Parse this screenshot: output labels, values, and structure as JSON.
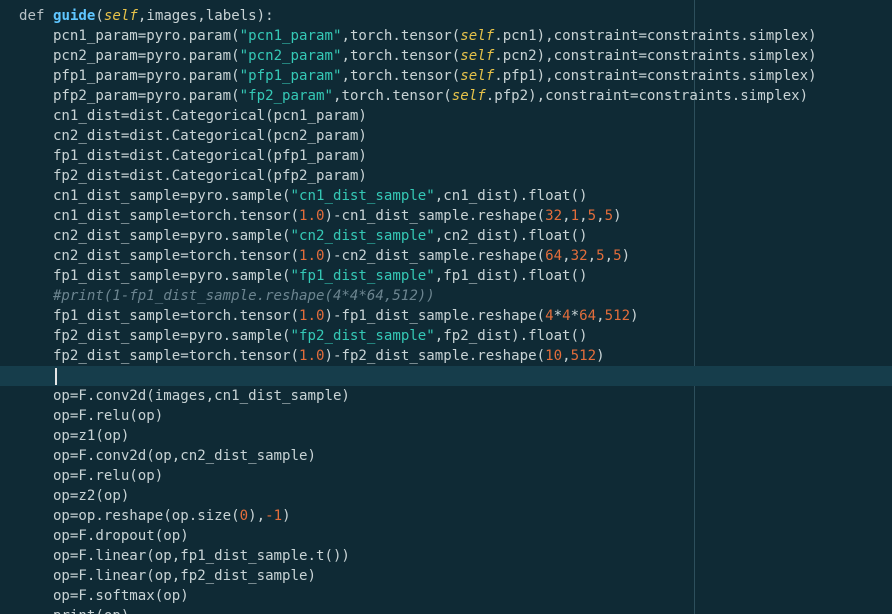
{
  "editor": {
    "colors": {
      "background": "#0f2a35",
      "current_line": "#163d4b",
      "ruler": "#2d4f5c",
      "text": "#c8d3d5",
      "function_name": "#5fc6ff",
      "self": "#e6c24a",
      "string": "#35c9b6",
      "number": "#e36d3b",
      "comment": "#6c8590"
    },
    "lines": [
      [
        {
          "t": "def",
          "c": "kw"
        },
        {
          "t": " "
        },
        {
          "t": "guide",
          "c": "fn"
        },
        {
          "t": "("
        },
        {
          "t": "self",
          "c": "self"
        },
        {
          "t": ",images,labels):"
        }
      ],
      [
        {
          "t": "    pcn1_param=pyro.param("
        },
        {
          "t": "\"pcn1_param\"",
          "c": "str"
        },
        {
          "t": ",torch.tensor("
        },
        {
          "t": "self",
          "c": "self"
        },
        {
          "t": ".pcn1),constraint=constraints.simplex)"
        }
      ],
      [
        {
          "t": "    pcn2_param=pyro.param("
        },
        {
          "t": "\"pcn2_param\"",
          "c": "str"
        },
        {
          "t": ",torch.tensor("
        },
        {
          "t": "self",
          "c": "self"
        },
        {
          "t": ".pcn2),constraint=constraints.simplex)"
        }
      ],
      [
        {
          "t": "    pfp1_param=pyro.param("
        },
        {
          "t": "\"pfp1_param\"",
          "c": "str"
        },
        {
          "t": ",torch.tensor("
        },
        {
          "t": "self",
          "c": "self"
        },
        {
          "t": ".pfp1),constraint=constraints.simplex)"
        }
      ],
      [
        {
          "t": "    pfp2_param=pyro.param("
        },
        {
          "t": "\"fp2_param\"",
          "c": "str"
        },
        {
          "t": ",torch.tensor("
        },
        {
          "t": "self",
          "c": "self"
        },
        {
          "t": ".pfp2),constraint=constraints.simplex)"
        }
      ],
      [
        {
          "t": "    cn1_dist=dist.Categorical(pcn1_param)"
        }
      ],
      [
        {
          "t": "    cn2_dist=dist.Categorical(pcn2_param)"
        }
      ],
      [
        {
          "t": "    fp1_dist=dist.Categorical(pfp1_param)"
        }
      ],
      [
        {
          "t": "    fp2_dist=dist.Categorical(pfp2_param)"
        }
      ],
      [
        {
          "t": "    cn1_dist_sample=pyro.sample("
        },
        {
          "t": "\"cn1_dist_sample\"",
          "c": "str"
        },
        {
          "t": ",cn1_dist).float()"
        }
      ],
      [
        {
          "t": "    cn1_dist_sample=torch.tensor("
        },
        {
          "t": "1.0",
          "c": "num"
        },
        {
          "t": ")-cn1_dist_sample.reshape("
        },
        {
          "t": "32",
          "c": "num"
        },
        {
          "t": ","
        },
        {
          "t": "1",
          "c": "num"
        },
        {
          "t": ","
        },
        {
          "t": "5",
          "c": "num"
        },
        {
          "t": ","
        },
        {
          "t": "5",
          "c": "num"
        },
        {
          "t": ")"
        }
      ],
      [
        {
          "t": "    cn2_dist_sample=pyro.sample("
        },
        {
          "t": "\"cn2_dist_sample\"",
          "c": "str"
        },
        {
          "t": ",cn2_dist).float()"
        }
      ],
      [
        {
          "t": "    cn2_dist_sample=torch.tensor("
        },
        {
          "t": "1.0",
          "c": "num"
        },
        {
          "t": ")-cn2_dist_sample.reshape("
        },
        {
          "t": "64",
          "c": "num"
        },
        {
          "t": ","
        },
        {
          "t": "32",
          "c": "num"
        },
        {
          "t": ","
        },
        {
          "t": "5",
          "c": "num"
        },
        {
          "t": ","
        },
        {
          "t": "5",
          "c": "num"
        },
        {
          "t": ")"
        }
      ],
      [
        {
          "t": "    fp1_dist_sample=pyro.sample("
        },
        {
          "t": "\"fp1_dist_sample\"",
          "c": "str"
        },
        {
          "t": ",fp1_dist).float()"
        }
      ],
      [
        {
          "t": "    #print(1-fp1_dist_sample.reshape(4*4*64,512))",
          "c": "cmt"
        }
      ],
      [
        {
          "t": "    fp1_dist_sample=torch.tensor("
        },
        {
          "t": "1.0",
          "c": "num"
        },
        {
          "t": ")-fp1_dist_sample.reshape("
        },
        {
          "t": "4",
          "c": "num"
        },
        {
          "t": "*"
        },
        {
          "t": "4",
          "c": "num"
        },
        {
          "t": "*"
        },
        {
          "t": "64",
          "c": "num"
        },
        {
          "t": ","
        },
        {
          "t": "512",
          "c": "num"
        },
        {
          "t": ")"
        }
      ],
      [
        {
          "t": "    fp2_dist_sample=pyro.sample("
        },
        {
          "t": "\"fp2_dist_sample\"",
          "c": "str"
        },
        {
          "t": ",fp2_dist).float()"
        }
      ],
      [
        {
          "t": "    fp2_dist_sample=torch.tensor("
        },
        {
          "t": "1.0",
          "c": "num"
        },
        {
          "t": ")-fp2_dist_sample.reshape("
        },
        {
          "t": "10",
          "c": "num"
        },
        {
          "t": ","
        },
        {
          "t": "512",
          "c": "num"
        },
        {
          "t": ")"
        }
      ],
      [
        {
          "t": "    "
        }
      ],
      [
        {
          "t": "    op=F.conv2d(images,cn1_dist_sample)"
        }
      ],
      [
        {
          "t": "    op=F.relu(op)"
        }
      ],
      [
        {
          "t": "    op=z1(op)"
        }
      ],
      [
        {
          "t": "    op=F.conv2d(op,cn2_dist_sample)"
        }
      ],
      [
        {
          "t": "    op=F.relu(op)"
        }
      ],
      [
        {
          "t": "    op=z2(op)"
        }
      ],
      [
        {
          "t": "    op=op.reshape(op.size("
        },
        {
          "t": "0",
          "c": "num"
        },
        {
          "t": "),"
        },
        {
          "t": "-1",
          "c": "num"
        },
        {
          "t": ")"
        }
      ],
      [
        {
          "t": "    op=F.dropout(op)"
        }
      ],
      [
        {
          "t": "    op=F.linear(op,fp1_dist_sample.t())"
        }
      ],
      [
        {
          "t": "    op=F.linear(op,fp2_dist_sample)"
        }
      ],
      [
        {
          "t": "    op=F.softmax(op)"
        }
      ],
      [
        {
          "t": "    print(op)"
        }
      ]
    ]
  }
}
